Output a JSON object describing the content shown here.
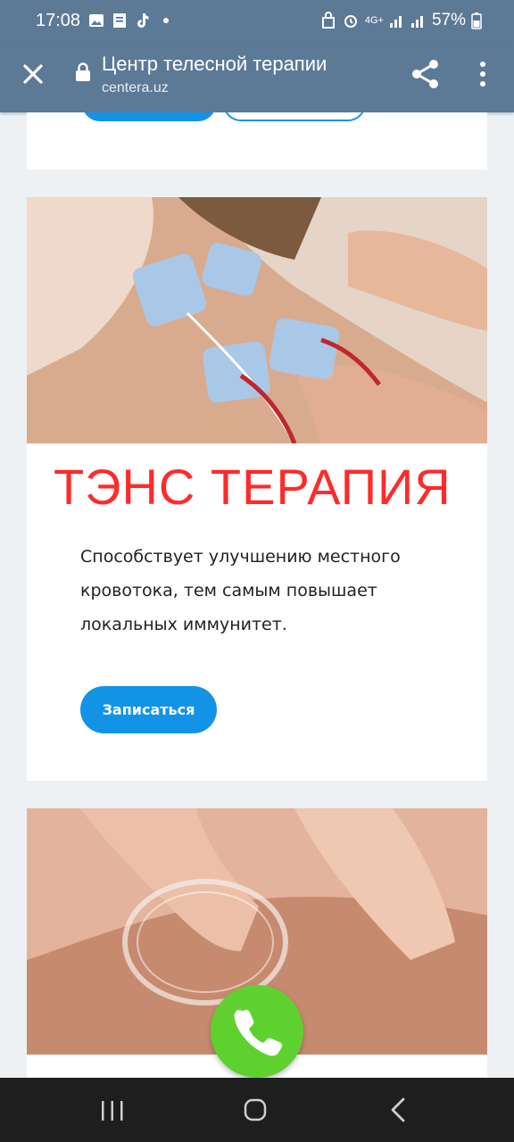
{
  "status_bar": {
    "time": "17:08",
    "network": "4G+",
    "battery": "57%",
    "icons": [
      "gallery-icon",
      "document-icon",
      "tiktok-icon",
      "dot-icon",
      "alarm-lock-icon",
      "alarm-icon",
      "signal-icon",
      "battery-icon"
    ]
  },
  "browser": {
    "title": "Центр телесной терапии",
    "url": "centera.uz",
    "icons": [
      "close-icon",
      "lock-icon",
      "share-icon",
      "more-vert-icon"
    ]
  },
  "tens_card": {
    "title": "ТЭНС ТЕРАПИЯ",
    "description": "Способствует улучшению местного кровотока, тем самым повышает локальных иммунитет.",
    "button_label": "Записаться"
  },
  "fab": {
    "icon": "phone-icon",
    "color": "#5fd12f"
  },
  "nav": {
    "icons": [
      "recent-apps-icon",
      "home-icon",
      "back-icon"
    ]
  },
  "colors": {
    "accent": "#1393e6",
    "header": "#5c7a96",
    "title_red": "#ff2b2b"
  }
}
